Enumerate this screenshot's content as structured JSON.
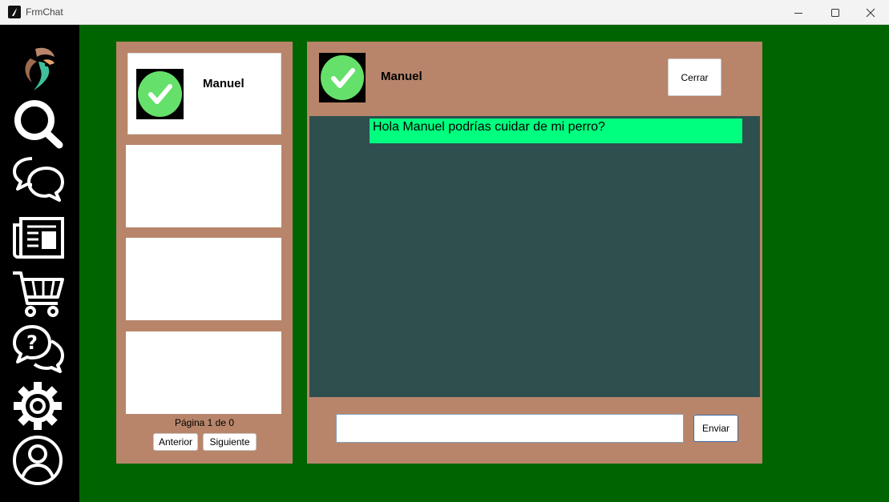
{
  "window": {
    "title": "FrmChat"
  },
  "sidebar": {
    "items": [
      {
        "icon": "brand-logo-icon"
      },
      {
        "icon": "search-icon"
      },
      {
        "icon": "chat-bubbles-icon"
      },
      {
        "icon": "newspaper-icon"
      },
      {
        "icon": "shopping-cart-icon"
      },
      {
        "icon": "help-chat-icon"
      },
      {
        "icon": "settings-gear-icon"
      },
      {
        "icon": "user-profile-icon"
      }
    ]
  },
  "contacts": {
    "items": [
      {
        "name": "Manuel"
      }
    ],
    "pager_text": "Página 1 de 0",
    "prev_label": "Anterior",
    "next_label": "Siguiente"
  },
  "chat": {
    "contact_name": "Manuel",
    "close_label": "Cerrar",
    "messages": [
      {
        "text": "Hola Manuel podrías cuidar de mi perro?"
      }
    ],
    "input_value": "",
    "send_label": "Enviar"
  },
  "colors": {
    "background": "#006400",
    "panel": "#b8856a",
    "chat_area": "#2f4f4f",
    "message_bubble": "#00ff7f",
    "avatar_check": "#65e06a",
    "sidebar": "#000000"
  }
}
